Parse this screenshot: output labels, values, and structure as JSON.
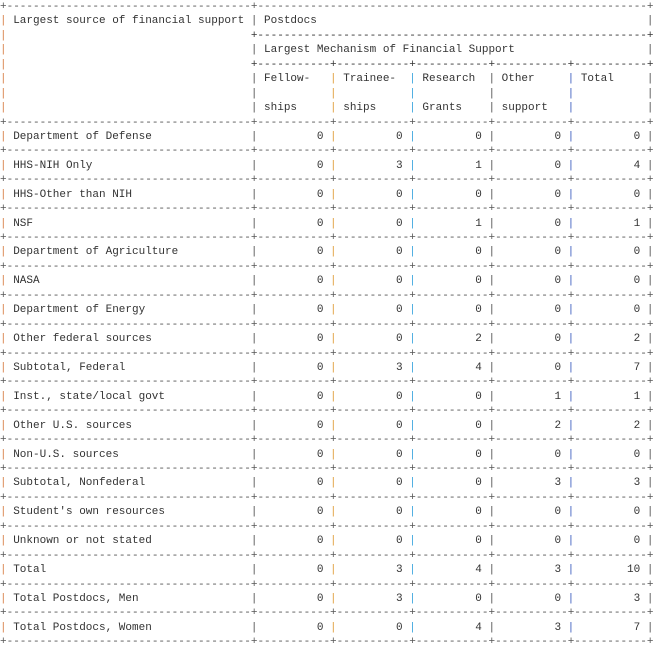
{
  "header": {
    "row_label_header": "Largest source of financial support",
    "group_title": "Postdocs",
    "subgroup_title": "Largest Mechanism of Financial Support",
    "columns": [
      {
        "line1": "Fellow-",
        "line2": "ships"
      },
      {
        "line1": "Trainee-",
        "line2": "ships"
      },
      {
        "line1": "Research",
        "line2": "Grants"
      },
      {
        "line1": "Other",
        "line2": "support"
      },
      {
        "line1": "Total",
        "line2": ""
      }
    ]
  },
  "rows": [
    {
      "label": "Department of Defense",
      "values": [
        "0",
        "0",
        "0",
        "0",
        "0"
      ]
    },
    {
      "label": "HHS-NIH Only",
      "values": [
        "0",
        "3",
        "1",
        "0",
        "4"
      ]
    },
    {
      "label": "HHS-Other than NIH",
      "values": [
        "0",
        "0",
        "0",
        "0",
        "0"
      ]
    },
    {
      "label": "NSF",
      "values": [
        "0",
        "0",
        "1",
        "0",
        "1"
      ]
    },
    {
      "label": "Department of Agriculture",
      "values": [
        "0",
        "0",
        "0",
        "0",
        "0"
      ]
    },
    {
      "label": "NASA",
      "values": [
        "0",
        "0",
        "0",
        "0",
        "0"
      ]
    },
    {
      "label": "Department of Energy",
      "values": [
        "0",
        "0",
        "0",
        "0",
        "0"
      ]
    },
    {
      "label": "Other federal sources",
      "values": [
        "0",
        "0",
        "2",
        "0",
        "2"
      ]
    },
    {
      "label": "Subtotal, Federal",
      "values": [
        "0",
        "3",
        "4",
        "0",
        "7"
      ]
    },
    {
      "label": "Inst., state/local govt",
      "values": [
        "0",
        "0",
        "0",
        "1",
        "1"
      ]
    },
    {
      "label": "Other U.S. sources",
      "values": [
        "0",
        "0",
        "0",
        "2",
        "2"
      ]
    },
    {
      "label": "Non-U.S. sources",
      "values": [
        "0",
        "0",
        "0",
        "0",
        "0"
      ]
    },
    {
      "label": "Subtotal, Nonfederal",
      "values": [
        "0",
        "0",
        "0",
        "3",
        "3"
      ]
    },
    {
      "label": "Student's own resources",
      "values": [
        "0",
        "0",
        "0",
        "0",
        "0"
      ]
    },
    {
      "label": "Unknown or not stated",
      "values": [
        "0",
        "0",
        "0",
        "0",
        "0"
      ]
    },
    {
      "label": "Total",
      "values": [
        "0",
        "3",
        "4",
        "3",
        "10"
      ]
    },
    {
      "label": "Total Postdocs, Men",
      "values": [
        "0",
        "3",
        "0",
        "0",
        "3"
      ]
    },
    {
      "label": "Total Postdocs, Women",
      "values": [
        "0",
        "0",
        "4",
        "3",
        "7"
      ]
    }
  ],
  "colors": {
    "pipes": [
      "#d9824b",
      "#555555",
      "#e0a040",
      "#40a8e0",
      "#555555",
      "#4060c0",
      "#555555"
    ]
  }
}
